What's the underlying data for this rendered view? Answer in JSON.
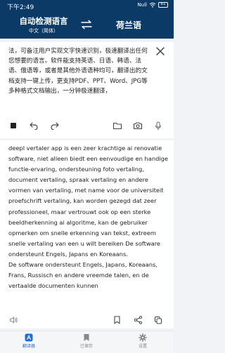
{
  "status_bar": {
    "time": "下午2:49",
    "signal_text": "Null",
    "battery": "61"
  },
  "header": {
    "source_lang": "自动检测语言",
    "source_lang_sub": "中文（简体）",
    "target_lang": "荷兰语"
  },
  "input": {
    "text": "法，可备注用户实现文字快速识别，极速翻译出任何您想要的语言。软件能支持英语、日语、韩语、法语、俄语等，或者是其他外语语种均可，翻译出的文档支持一键上传，更支持PDF、PPT、Word、JPG等多种格式文档输出，一分钟极速翻译，"
  },
  "output": {
    "text": "deepl vertaler app is een zeer krachtige ai renovatie software, niet alleen biedt een eenvoudige en handige functie-ervaring, ondersteuning foto vertaling, document vertaling, spraak vertaling en andere vormen van vertaling, met name voor de universiteit proefschrift vertaling, kan worden gezegd dat zeer professioneel, maar vertrouwt ook op een sterke beeldherkenning ai algoritme, kan de gebruiker opmerken om snelle erkenning van tekst, extreem snelle vertaling van een u wilt bereiken De software ondersteunt Engels, Japans en Koreaans.\nDe software ondersteunt Engels, Japans, Koreaans, Frans, Russisch en andere vreemde talen, en de vertaalde documenten kunnen"
  },
  "nav": {
    "translate": "翻译器",
    "saved": "已保存",
    "settings": "设置"
  },
  "colors": {
    "header_bg": "#0b3a66",
    "accent": "#1f6fd1",
    "icon": "#444444",
    "nav_inactive": "#888888"
  },
  "icons": {
    "input_toolbar": [
      "stop-icon",
      "undo-icon",
      "redo-icon",
      "folder-icon",
      "camera-icon",
      "microphone-icon"
    ],
    "output_toolbar": [
      "speaker-icon",
      "bookmark-icon",
      "share-icon",
      "copy-icon"
    ]
  }
}
